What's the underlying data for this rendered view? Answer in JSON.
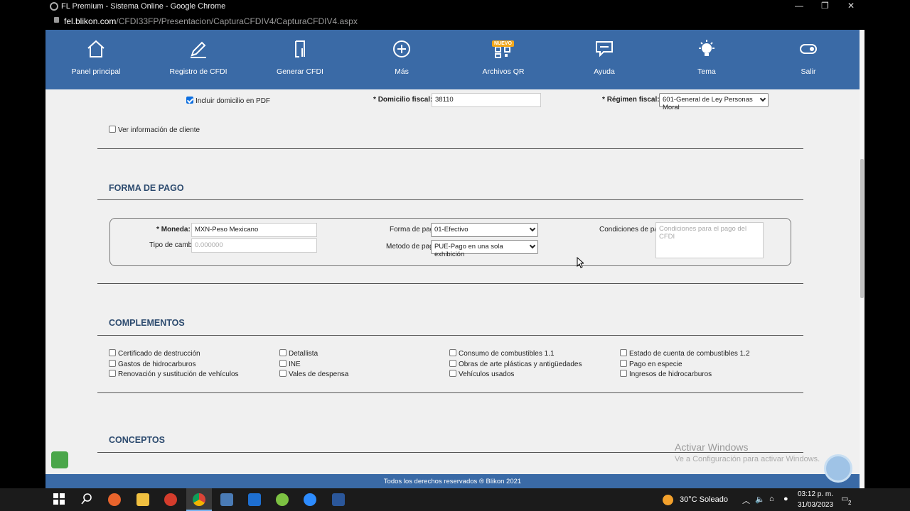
{
  "browser": {
    "title": "FL Premium - Sistema Online - Google Chrome",
    "host": "fel.blikon.com",
    "path": "/CFDI33FP/Presentacion/CapturaCFDIV4/CapturaCFDIV4.aspx",
    "win_min": "—",
    "win_restore": "❐",
    "win_close": "✕"
  },
  "nav": {
    "items": [
      {
        "label": "Panel principal",
        "icon": "home-icon"
      },
      {
        "label": "Registro de CFDI",
        "icon": "edit-icon"
      },
      {
        "label": "Generar CFDI",
        "icon": "document-edit-icon"
      },
      {
        "label": "Más",
        "icon": "plus-circle-icon"
      },
      {
        "label": "Archivos QR",
        "icon": "qr-icon",
        "badge": "NUEVO"
      },
      {
        "label": "Ayuda",
        "icon": "chat-icon"
      },
      {
        "label": "Tema",
        "icon": "bulb-icon"
      },
      {
        "label": "Salir",
        "icon": "toggle-icon"
      }
    ]
  },
  "cliente": {
    "incluir_domicilio": "Incluir domicilio en PDF",
    "domicilio_label": "Domicilio fiscal:",
    "domicilio_value": "38110",
    "regimen_label": "Régimen fiscal:",
    "regimen_value": "601-General de Ley Personas Moral",
    "ver_info": "Ver información de cliente",
    "required_mark": "*"
  },
  "forma_pago": {
    "title": "FORMA DE PAGO",
    "moneda_label": "Moneda:",
    "moneda_value": "MXN-Peso Mexicano",
    "tipo_cambio_label": "Tipo de cambio:",
    "tipo_cambio_placeholder": "0.000000",
    "forma_label": "Forma de pago:",
    "forma_value": "01-Efectivo",
    "metodo_label": "Metodo de pago:",
    "metodo_value": "PUE-Pago en una sola exhibición",
    "condiciones_label": "Condiciones de pago:",
    "condiciones_placeholder": "Condiciones para el pago del CFDI"
  },
  "complementos": {
    "title": "COMPLEMENTOS",
    "items": [
      "Certificado de destrucción",
      "Gastos de hidrocarburos",
      "Renovación y sustitución de vehículos",
      "Detallista",
      "INE",
      "Vales de despensa",
      "Consumo de combustibles 1.1",
      "Obras de arte plásticas y antigüedades",
      "Vehículos usados",
      "Estado de cuenta de combustibles 1.2",
      "Pago en especie",
      "Ingresos de hidrocarburos"
    ]
  },
  "conceptos": {
    "title": "CONCEPTOS"
  },
  "footer": {
    "text": "Todos los derechos reservados ® Blikon 2021"
  },
  "watermark": {
    "line1": "Activar Windows",
    "line2": "Ve a Configuración para activar Windows."
  },
  "taskbar": {
    "weather": "30°C  Soleado",
    "time": "03:12 p. m.",
    "date": "31/03/2023",
    "notif_count": "2",
    "colors": {
      "accent": "#3a6aa6"
    }
  }
}
